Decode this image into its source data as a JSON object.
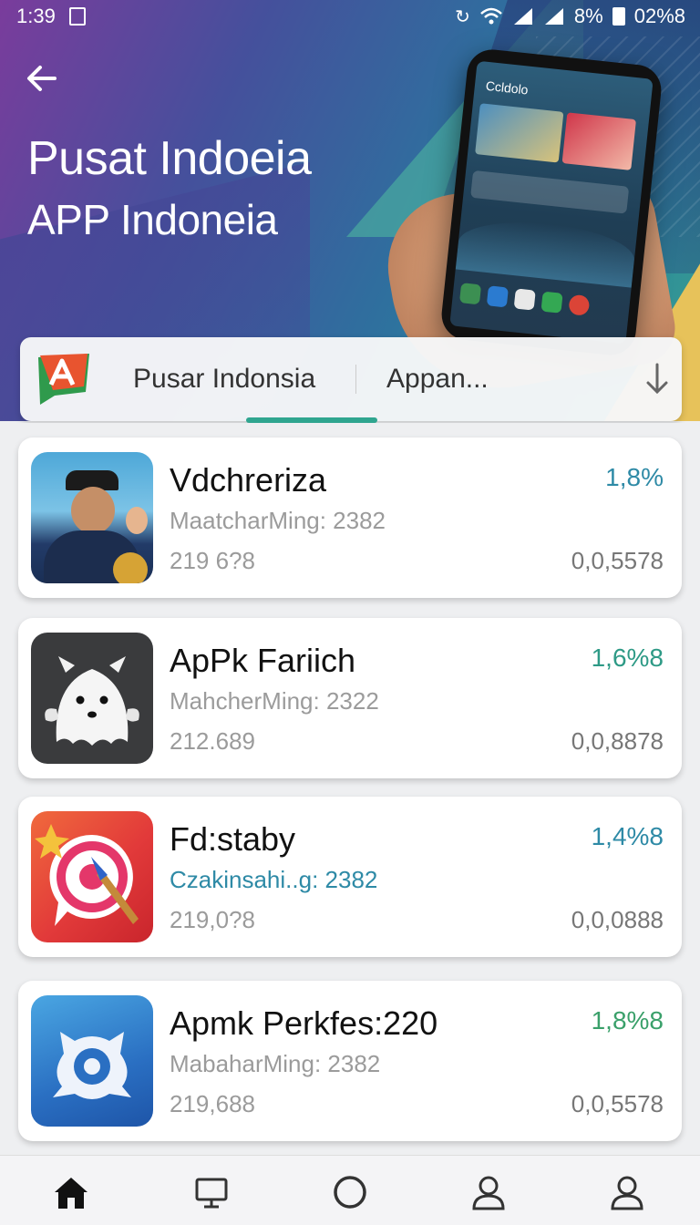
{
  "status_bar": {
    "time": "1:39",
    "battery": "8%",
    "clock_right": "02%8",
    "icons": [
      "sim-icon",
      "sync-icon",
      "wifi-icon",
      "signal-icon",
      "signal-icon",
      "battery-icon"
    ]
  },
  "hero": {
    "title": "Pusat Indoeia",
    "subtitle": "APP Indoneia",
    "phone_title": "Ccldolo"
  },
  "search": {
    "label": "Pusar Indonsia",
    "selected": "Appan..."
  },
  "apps": [
    {
      "name": "Vdchreriza",
      "subtitle": "MaatcharMing: 2382",
      "subtitle_style": "gray",
      "count": "219 6?8",
      "percent": "1,8%",
      "percent_color": "#2e8aa6",
      "value": "0,0,5578",
      "icon": "person-photo-icon"
    },
    {
      "name": "ApPk Fariich",
      "subtitle": "MahcherMing: 2322",
      "subtitle_style": "gray",
      "count": "212.689",
      "percent": "1,6%8",
      "percent_color": "#2e9a86",
      "value": "0,0,8878",
      "icon": "ghost-icon"
    },
    {
      "name": "Fd:staby",
      "subtitle": "Czakinsahi..g: 2382",
      "subtitle_style": "teal",
      "count": "219,0?8",
      "percent": "1,4%8",
      "percent_color": "#2e8aa6",
      "value": "0,0,0888",
      "icon": "paint-target-icon"
    },
    {
      "name": "Apmk Perkfes:220",
      "subtitle": "MabaharMing: 2382",
      "subtitle_style": "gray",
      "count": "219,688",
      "percent": "1,8%8",
      "percent_color": "#3aa06a",
      "value": "0,0,5578",
      "icon": "blue-creature-icon"
    }
  ],
  "nav": [
    "home-icon",
    "monitor-icon",
    "circle-icon",
    "person-icon",
    "profile-icon"
  ]
}
